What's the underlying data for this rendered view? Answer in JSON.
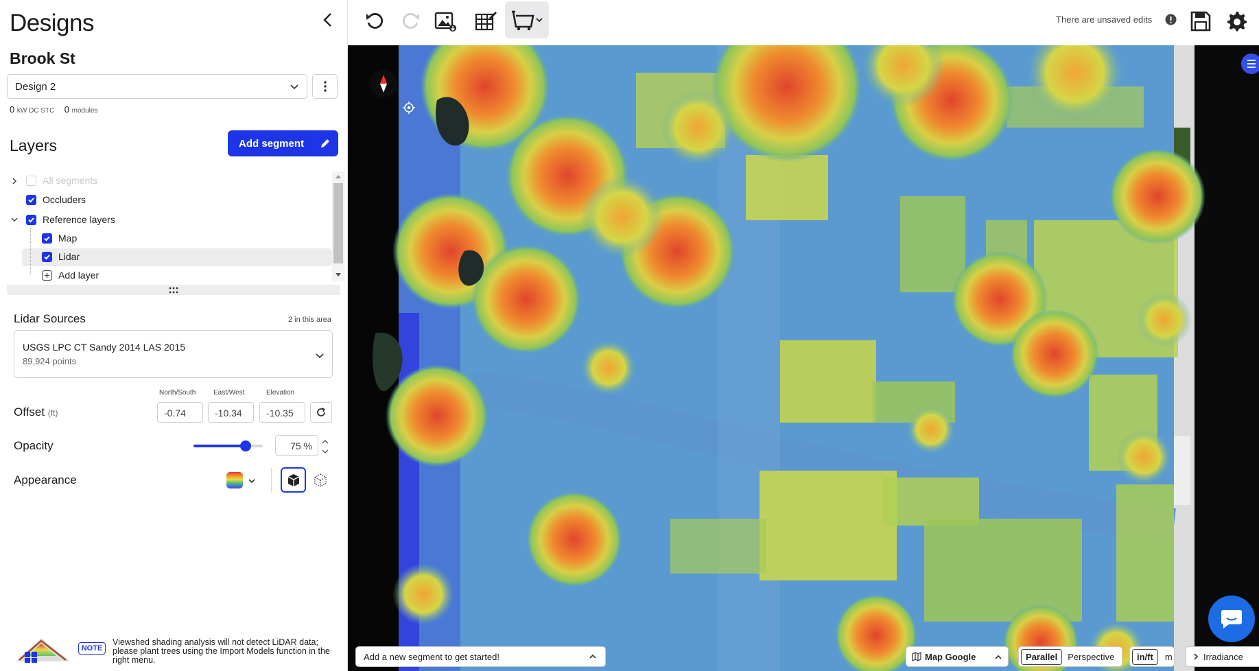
{
  "sidebar": {
    "title": "Designs",
    "project_name": "Brook St",
    "design_selected": "Design 2",
    "stats": {
      "kw_value": "0",
      "kw_unit": "kW DC STC",
      "modules_value": "0",
      "modules_unit": "modules"
    },
    "layers": {
      "title": "Layers",
      "add_segment_label": "Add segment",
      "items": [
        {
          "label": "All segments",
          "checked": false,
          "disabled": true
        },
        {
          "label": "Occluders",
          "checked": true
        },
        {
          "label": "Reference layers",
          "checked": true
        },
        {
          "label": "Map",
          "checked": true
        },
        {
          "label": "Lidar",
          "checked": true,
          "selected": true
        },
        {
          "label": "Add layer"
        }
      ]
    },
    "lidar": {
      "title": "Lidar Sources",
      "count_text": "2 in this area",
      "source_name": "USGS LPC CT Sandy 2014 LAS 2015",
      "source_points": "89,924 points"
    },
    "offset": {
      "label": "Offset",
      "unit": "(ft)",
      "north_south_label": "North/South",
      "east_west_label": "East/West",
      "elevation_label": "Elevation",
      "north_south": "-0.74",
      "east_west": "-10.34",
      "elevation": "-10.35"
    },
    "opacity": {
      "label": "Opacity",
      "value_text": "75 %",
      "value": 0.75
    },
    "appearance": {
      "label": "Appearance"
    },
    "note": {
      "badge": "NOTE",
      "text": "Viewshed shading analysis will not detect LiDAR data; please plant trees using the Import Models function in the right menu."
    }
  },
  "toolbar": {
    "unsaved_text": "There are unsaved edits",
    "icons": [
      "undo-icon",
      "redo-icon",
      "export-image-icon",
      "edit-grid-icon",
      "draw-roof-icon",
      "save-icon",
      "settings-icon"
    ]
  },
  "map": {
    "segment_hint": "Add a new segment to get started!",
    "basemap_label": "Map Google",
    "projection_parallel": "Parallel",
    "projection_perspective": "Perspective",
    "unit_imperial": "in/ft",
    "unit_metric": "m",
    "irradiance_label": "Irradiance"
  },
  "colors": {
    "accent": "#1d35e6",
    "heat_low": "#3f6fd6",
    "heat_mid": "#c9d84a",
    "heat_high": "#e0452c"
  }
}
